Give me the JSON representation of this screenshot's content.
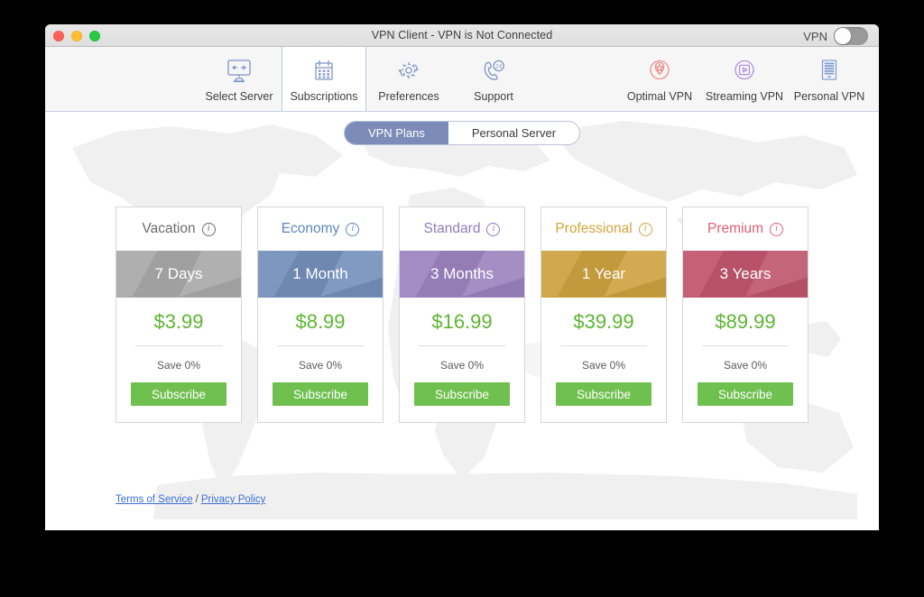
{
  "window": {
    "title": "VPN Client - VPN is Not Connected",
    "traffic_lights": {
      "close": "close",
      "minimize": "minimize",
      "maximize": "maximize"
    },
    "vpn_toggle": {
      "label": "VPN",
      "state": "off"
    }
  },
  "toolbar": {
    "items": [
      {
        "label": "Select Server",
        "icon": "monitor-arrows-icon",
        "selected": false,
        "color": "#7f94c4"
      },
      {
        "label": "Subscriptions",
        "icon": "calendar-icon",
        "selected": true,
        "color": "#7f94c4"
      },
      {
        "label": "Preferences",
        "icon": "gear-refresh-icon",
        "selected": false,
        "color": "#7f94c4"
      },
      {
        "label": "Support",
        "icon": "phone-24-icon",
        "selected": false,
        "color": "#7f94c4"
      },
      {
        "label": "Optimal VPN",
        "icon": "star-pin-icon",
        "selected": false,
        "color": "#ef8a8a"
      },
      {
        "label": "Streaming VPN",
        "icon": "play-circle-icon",
        "selected": false,
        "color": "#b08ede"
      },
      {
        "label": "Personal VPN",
        "icon": "server-rack-icon",
        "selected": false,
        "color": "#7f9fd0"
      }
    ]
  },
  "segmented_control": {
    "options": [
      {
        "label": "VPN Plans",
        "active": true
      },
      {
        "label": "Personal Server",
        "active": false
      }
    ],
    "active_color": "#7c8cb9"
  },
  "plans": [
    {
      "name": "Vacation",
      "duration": "7 Days",
      "price": "$3.99",
      "save": "Save 0%",
      "button": "Subscribe",
      "title_color": "#6b6b6b",
      "banner_color": "#a9a9a9"
    },
    {
      "name": "Economy",
      "duration": "1 Month",
      "price": "$8.99",
      "save": "Save 0%",
      "button": "Subscribe",
      "title_color": "#5e86bd",
      "banner_color": "#7490bb"
    },
    {
      "name": "Standard",
      "duration": "3 Months",
      "price": "$16.99",
      "save": "Save 0%",
      "button": "Subscribe",
      "title_color": "#8f7bbd",
      "banner_color": "#9c83bf"
    },
    {
      "name": "Professional",
      "duration": "1 Year",
      "price": "$39.99",
      "save": "Save 0%",
      "button": "Subscribe",
      "title_color": "#d5a33c",
      "banner_color": "#cda240"
    },
    {
      "name": "Premium",
      "duration": "3 Years",
      "price": "$89.99",
      "save": "Save 0%",
      "button": "Subscribe",
      "title_color": "#e05e78",
      "banner_color": "#c0566d"
    }
  ],
  "footer": {
    "terms_label": "Terms of Service",
    "separator": "/",
    "privacy_label": "Privacy Policy",
    "link_color": "#3b6fd4"
  },
  "colors": {
    "accent_green": "#6fc04f",
    "price_green": "#5cb531",
    "toolbar_bg": "#f6f6f6",
    "titlebar_bg": "#e4e4e4",
    "page_bg": "#000000"
  }
}
